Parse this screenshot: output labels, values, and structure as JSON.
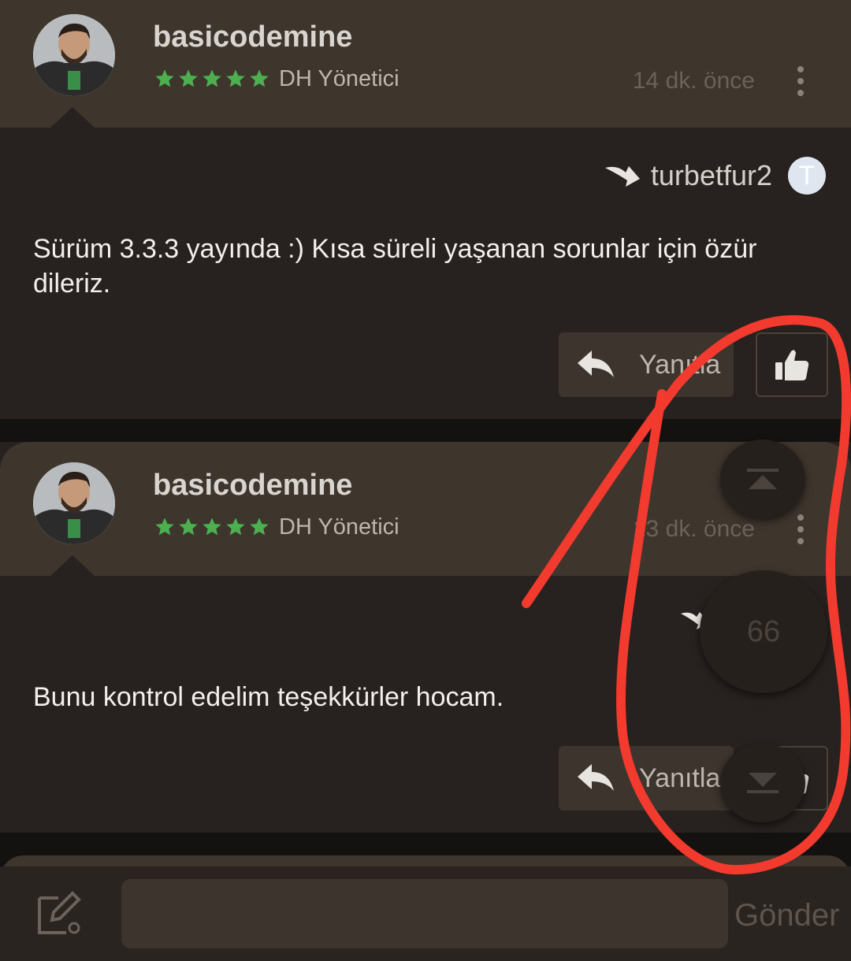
{
  "posts": [
    {
      "username": "basicodemine",
      "role": "DH Yönetici",
      "time": "14 dk. önce",
      "quoted_user": "turbetfur2",
      "quoted_avatar_letter": "T",
      "text": "Sürüm 3.3.3 yayında :) Kısa süreli yaşanan sorunlar için özür dileriz.",
      "reply_label": "Yanıtla"
    },
    {
      "username": "basicodemine",
      "role": "DH Yönetici",
      "time": "13 dk. önce",
      "text": "Bunu kontrol edelim teşekkürler hocam.",
      "reply_label": "Yanıtla"
    }
  ],
  "rating_stars": 5,
  "scroll_controls": {
    "top_icon": "scroll-top-icon",
    "count": "66",
    "bottom_icon": "scroll-bottom-icon"
  },
  "composer": {
    "placeholder": "",
    "send_label": "Gönder"
  },
  "colors": {
    "header_bg": "#3e352d",
    "body_bg": "#27211f",
    "star_green": "#4caf50",
    "annotation_red": "#f23a2e"
  }
}
